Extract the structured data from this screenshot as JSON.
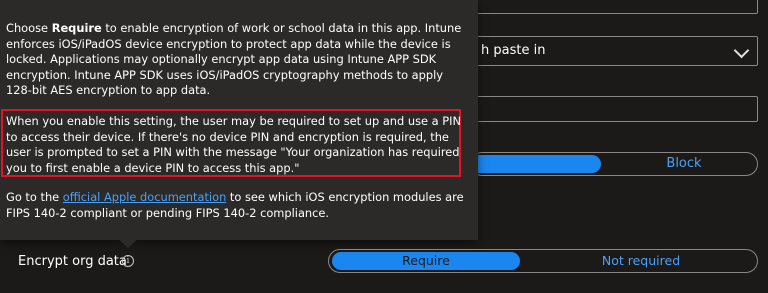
{
  "background": {
    "dropdown_value": "h paste in",
    "block_label": "Block"
  },
  "tooltip": {
    "p1_before": "Choose ",
    "p1_bold": "Require",
    "p1_after": " to enable encryption of work or school data in this app. Intune enforces iOS/iPadOS device encryption to protect app data while the device is locked. Applications may optionally encrypt app data using Intune APP SDK encryption. Intune APP SDK uses iOS/iPadOS cryptography methods to apply 128-bit AES encryption to app data.",
    "p2": "When you enable this setting, the user may be required to set up and use a PIN to access their device. If there's no device PIN and encryption is required, the user is prompted to set a PIN with the message \"Your organization has required you to first enable a device PIN to access this app.\"",
    "p3_before": "Go to the ",
    "p3_link": "official Apple documentation",
    "p3_after": " to see which iOS encryption modules are FIPS 140-2 compliant or pending FIPS 140-2 compliance."
  },
  "setting": {
    "label": "Encrypt org data",
    "info_icon": "i",
    "options": [
      "Require",
      "Not required"
    ],
    "selected": "Require"
  },
  "colors": {
    "accent": "#1a86f0",
    "highlight_border": "#e81123",
    "link": "#4aa0f8"
  }
}
